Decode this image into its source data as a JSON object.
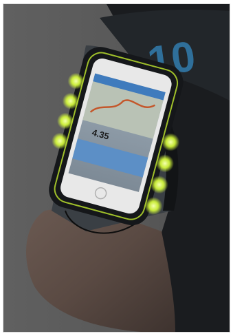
{
  "photo": {
    "jersey_number": "10",
    "phone_distance_readout": "4.35",
    "led_color": "#d9ff3a",
    "jersey_accent_color": "#2f6f9a"
  }
}
